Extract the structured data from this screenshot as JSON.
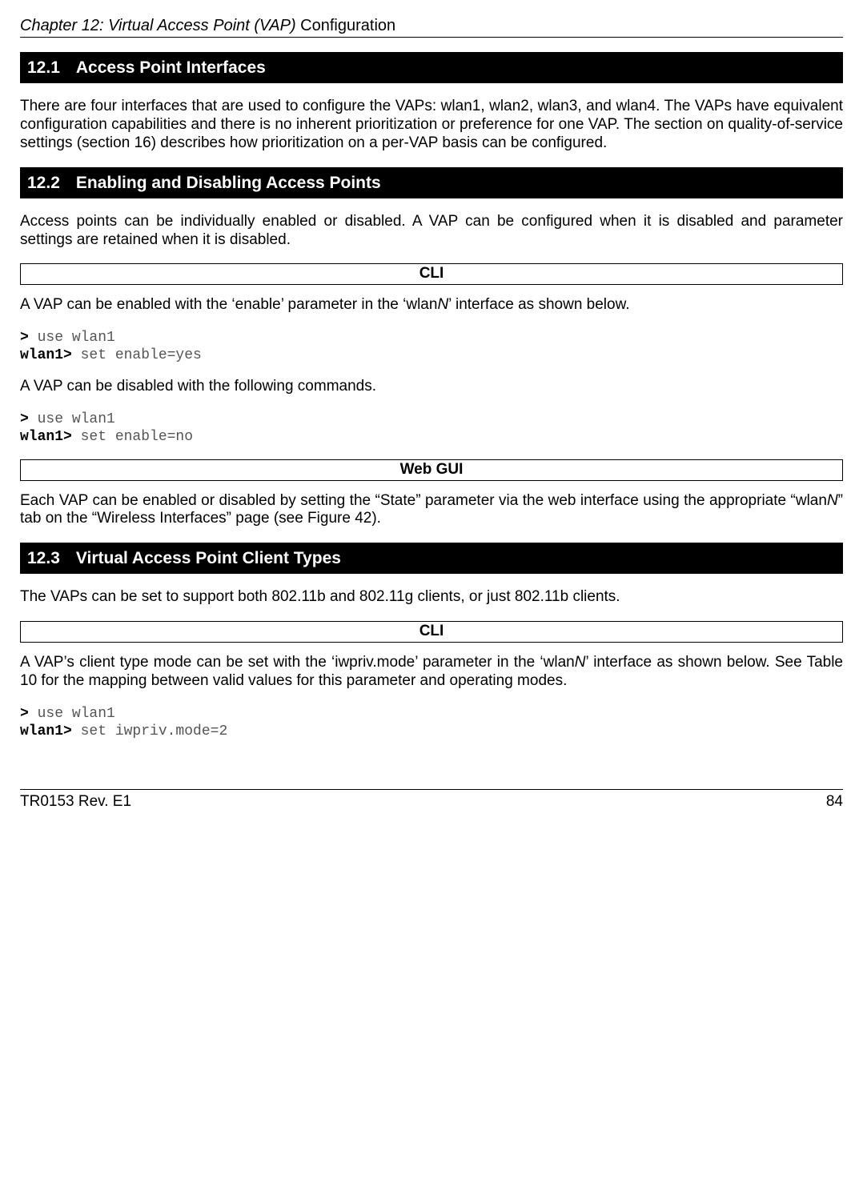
{
  "chapter": {
    "prefix": "Chapter 12: Virtual Access Point (VAP) ",
    "suffix": "Configuration"
  },
  "sections": {
    "s1": {
      "num": "12.1",
      "title": "Access Point Interfaces",
      "body": "There are four interfaces that are used to configure the VAPs: wlan1, wlan2, wlan3, and wlan4. The VAPs have equivalent configuration capabilities and there is no inherent prioritization or preference for one VAP. The section on quality-of-service settings (section 16) describes how prioritization on a per-VAP basis can be configured."
    },
    "s2": {
      "num": "12.2",
      "title": "Enabling and Disabling Access Points",
      "body": "Access points can be individually enabled or disabled. A VAP can be configured when it is disabled and parameter settings are retained when it is disabled.",
      "cli_label": "CLI",
      "cli_intro_a": "A VAP can be enabled with the ‘enable’ parameter in the ‘wlan",
      "cli_intro_b": "N",
      "cli_intro_c": "’ interface as shown below.",
      "cli1_p1": ">",
      "cli1_c1": " use wlan1",
      "cli1_p2": "wlan1>",
      "cli1_c2": " set enable=yes",
      "cli_mid": "A VAP can be disabled with the following commands.",
      "cli2_p1": ">",
      "cli2_c1": " use wlan1",
      "cli2_p2": "wlan1>",
      "cli2_c2": " set enable=no",
      "webgui_label": "Web GUI",
      "webgui_a": "Each VAP can be enabled or disabled by setting the “State” parameter via the web interface using the appropriate “wlan",
      "webgui_b": "N",
      "webgui_c": "” tab on the “Wireless Interfaces” page (see Figure 42)."
    },
    "s3": {
      "num": "12.3",
      "title": "Virtual Access Point Client Types",
      "body": "The VAPs can be set to support both 802.11b and 802.11g clients, or just 802.11b clients.",
      "cli_label": "CLI",
      "cli_intro_a": "A VAP’s client type mode can be set with the ‘iwpriv.mode’ parameter in the ‘wlan",
      "cli_intro_b": "N",
      "cli_intro_c": "’ interface as shown below. See Table 10 for the mapping between valid values for this parameter and operating modes.",
      "cli1_p1": ">",
      "cli1_c1": " use wlan1",
      "cli1_p2": "wlan1>",
      "cli1_c2": " set iwpriv.mode=2"
    }
  },
  "footer": {
    "left": "TR0153 Rev. E1",
    "right": "84"
  }
}
